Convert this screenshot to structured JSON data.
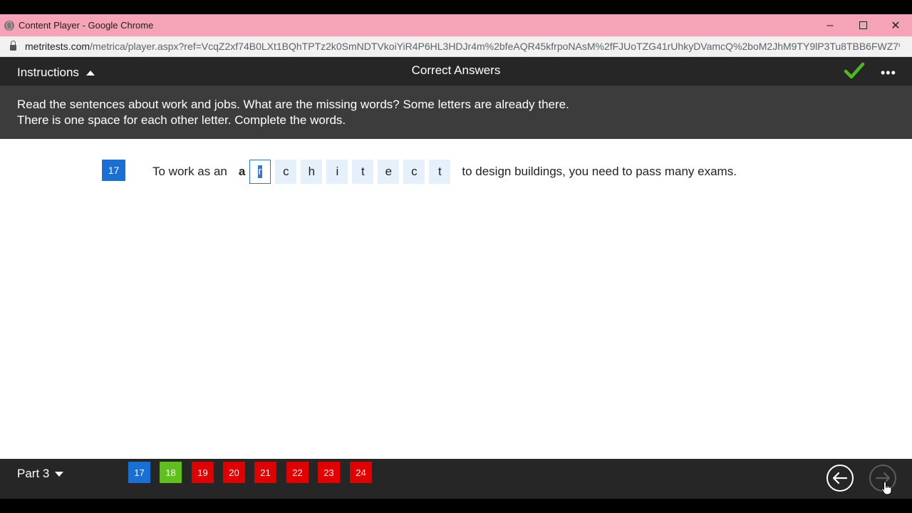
{
  "window": {
    "title": "Content Player - Google Chrome"
  },
  "browser": {
    "url_host": "metritests.com",
    "url_path": "/metrica/player.aspx?ref=VcqZ2xf74B0LXt1BQhTPTz2k0SmNDTVkoiYiR4P6HL3HDJr4m%2bfeAQR45kfrpoNAsM%2fFJUoTZG41rUhkyDVamcQ%2boM2JhM9TY9lP3Tu8TBB6FWZ7%2f..."
  },
  "header": {
    "instructions_label": "Instructions",
    "title": "Correct Answers",
    "more_label": "•••"
  },
  "instructions": {
    "line1": "Read the sentences about work and jobs. What are the missing words? Some letters are already there.",
    "line2": "There is one space for each other letter. Complete the words."
  },
  "question": {
    "number": "17",
    "before": "To work as an",
    "given_letter": "a",
    "letters": [
      "r",
      "c",
      "h",
      "i",
      "t",
      "e",
      "c",
      "t"
    ],
    "after": "to design buildings, you need to pass many exams."
  },
  "footer": {
    "part_label": "Part 3",
    "nav": [
      {
        "label": "17",
        "color": "#1a6fd4"
      },
      {
        "label": "18",
        "color": "#5fbf1f"
      },
      {
        "label": "19",
        "color": "#e00000"
      },
      {
        "label": "20",
        "color": "#e00000"
      },
      {
        "label": "21",
        "color": "#e00000"
      },
      {
        "label": "22",
        "color": "#e00000"
      },
      {
        "label": "23",
        "color": "#e00000"
      },
      {
        "label": "24",
        "color": "#e00000"
      }
    ]
  },
  "colors": {
    "check": "#4cba1a",
    "accent_blue": "#1a6fd4"
  }
}
